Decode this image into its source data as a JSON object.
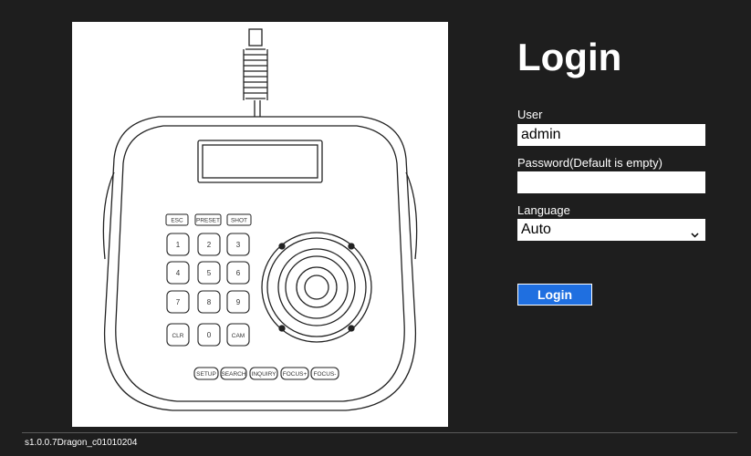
{
  "login": {
    "title": "Login",
    "user_label": "User",
    "user_value": "admin",
    "password_label": "Password(Default is empty)",
    "password_value": "",
    "language_label": "Language",
    "language_selected": "Auto",
    "login_button_label": "Login"
  },
  "device_keys": {
    "top": [
      "ESC",
      "PRESET",
      "SHOT"
    ],
    "numpad": [
      "1",
      "2",
      "3",
      "4",
      "5",
      "6",
      "7",
      "8",
      "9",
      "CLR",
      "0",
      "CAM"
    ],
    "bottom": [
      "SETUP",
      "SEARCH",
      "INQUIRY",
      "FOCUS+",
      "FOCUS-"
    ]
  },
  "footer": {
    "version": "s1.0.0.7Dragon_c01010204"
  },
  "colors": {
    "background": "#1e1e1e",
    "button": "#1f6fe0",
    "panel": "#ffffff"
  },
  "icons": {
    "dropdown": "chevron-down-icon"
  }
}
